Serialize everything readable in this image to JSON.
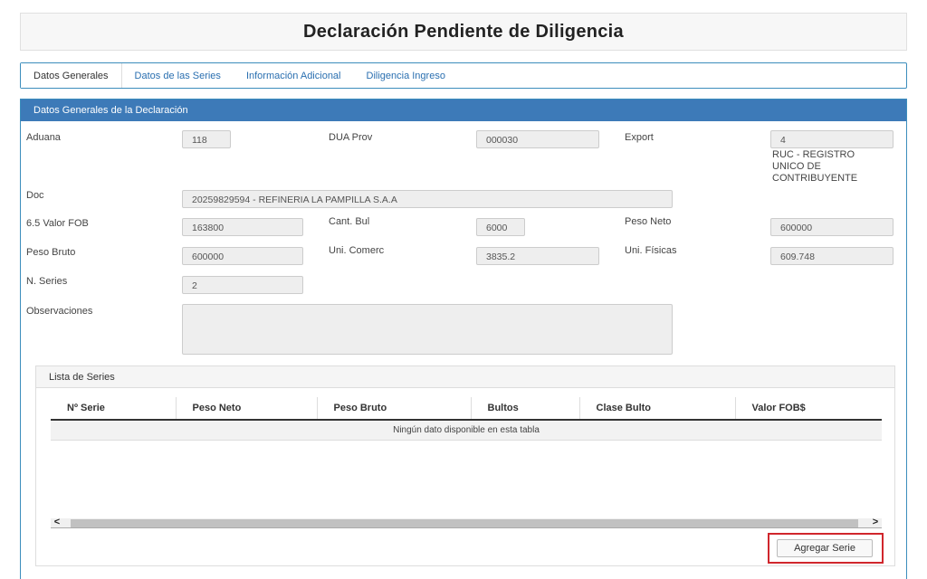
{
  "header": {
    "title": "Declaración Pendiente de Diligencia"
  },
  "tabs": [
    {
      "label": "Datos Generales",
      "active": true
    },
    {
      "label": "Datos de las Series",
      "active": false
    },
    {
      "label": "Información Adicional",
      "active": false
    },
    {
      "label": "Diligencia Ingreso",
      "active": false
    }
  ],
  "panel": {
    "heading": "Datos Generales de la Declaración"
  },
  "form": {
    "aduana": {
      "label": "Aduana",
      "value": "118"
    },
    "dua_prov": {
      "label": "DUA Prov",
      "value": "000030"
    },
    "export": {
      "label": "Export",
      "value": "4",
      "ruc_lines": [
        "RUC - REGISTRO",
        "UNICO DE",
        "CONTRIBUYENTE"
      ]
    },
    "doc": {
      "label": "Doc",
      "value": "20259829594 - REFINERIA LA PAMPILLA S.A.A"
    },
    "valor_fob": {
      "label": "6.5 Valor FOB",
      "value": "163800"
    },
    "cant_bul": {
      "label": "Cant. Bul",
      "value": "6000"
    },
    "peso_neto": {
      "label": "Peso Neto",
      "value": "600000"
    },
    "peso_bruto": {
      "label": "Peso Bruto",
      "value": "600000"
    },
    "uni_comerc": {
      "label": "Uni. Comerc",
      "value": "3835.2"
    },
    "uni_fisicas": {
      "label": "Uni. Físicas",
      "value": "609.748"
    },
    "n_series": {
      "label": "N. Series",
      "value": "2"
    },
    "observaciones": {
      "label": "Observaciones",
      "value": ""
    }
  },
  "series": {
    "heading": "Lista de Series",
    "columns": [
      "Nº Serie",
      "Peso Neto",
      "Peso Bruto",
      "Bultos",
      "Clase Bulto",
      "Valor FOB$"
    ],
    "empty_message": "Ningún dato disponible en esta tabla",
    "scroll_left": "<",
    "scroll_right": ">",
    "add_button": "Agregar Serie"
  },
  "colors": {
    "accent": "#3d7ab8",
    "tab_link": "#2a6fb0",
    "highlight": "#d0262c"
  }
}
